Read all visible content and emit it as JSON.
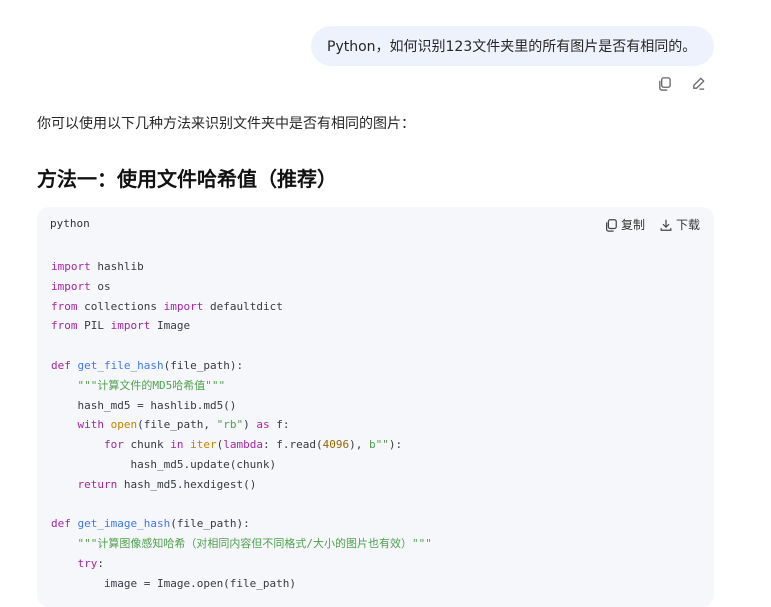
{
  "user_message": "Python，如何识别123文件夹里的所有图片是否有相同的。",
  "message_actions": {
    "copy_icon": "copy-icon",
    "edit_icon": "edit-icon"
  },
  "answer": {
    "intro": "你可以使用以下几种方法来识别文件夹中是否有相同的图片：",
    "heading": "方法一：使用文件哈希值（推荐）"
  },
  "code_block": {
    "language": "python",
    "copy_label": "复制",
    "download_label": "下载",
    "lines": [
      [
        [
          "kw",
          "import"
        ],
        [
          "",
          "hashlib"
        ]
      ],
      [
        [
          "kw",
          "import"
        ],
        [
          "",
          "os"
        ]
      ],
      [
        [
          "kw",
          "from"
        ],
        [
          "",
          "collections"
        ],
        [
          "kw",
          "import"
        ],
        [
          "",
          "defaultdict"
        ]
      ],
      [
        [
          "kw",
          "from"
        ],
        [
          "",
          "PIL"
        ],
        [
          "kw",
          "import"
        ],
        [
          "",
          "Image"
        ]
      ],
      [],
      [
        [
          "kw",
          "def"
        ],
        [
          "fn",
          "get_file_hash"
        ],
        [
          "",
          "(file_path):"
        ]
      ],
      [
        [
          "",
          "    "
        ],
        [
          "str",
          "\"\"\"计算文件的MD5哈希值\"\"\""
        ]
      ],
      [
        [
          "",
          "    hash_md5 = hashlib.md5()"
        ]
      ],
      [
        [
          "",
          "    "
        ],
        [
          "kw",
          "with"
        ],
        [
          "bi",
          "open"
        ],
        [
          "",
          "(file_path, "
        ],
        [
          "str",
          "\"rb\""
        ],
        [
          "",
          ") "
        ],
        [
          "kw",
          "as"
        ],
        [
          "",
          "f:"
        ]
      ],
      [
        [
          "",
          "        "
        ],
        [
          "kw",
          "for"
        ],
        [
          "",
          "chunk "
        ],
        [
          "kw",
          "in"
        ],
        [
          "bi",
          "iter"
        ],
        [
          "",
          "("
        ],
        [
          "kw",
          "lambda"
        ],
        [
          "",
          ": f.read("
        ],
        [
          "num",
          "4096"
        ],
        [
          "",
          "), "
        ],
        [
          "str",
          "b\"\""
        ],
        [
          "",
          "):"
        ]
      ],
      [
        [
          "",
          "            hash_md5.update(chunk)"
        ]
      ],
      [
        [
          "",
          "    "
        ],
        [
          "kw",
          "return"
        ],
        [
          "",
          "hash_md5.hexdigest()"
        ]
      ],
      [],
      [
        [
          "kw",
          "def"
        ],
        [
          "fn",
          "get_image_hash"
        ],
        [
          "",
          "(file_path):"
        ]
      ],
      [
        [
          "",
          "    "
        ],
        [
          "str",
          "\"\"\"计算图像感知哈希（对相同内容但不同格式/大小的图片也有效）\"\"\""
        ]
      ],
      [
        [
          "",
          "    "
        ],
        [
          "kw",
          "try"
        ],
        [
          "",
          ":"
        ]
      ],
      [
        [
          "",
          "        image = Image.open(file_path)"
        ]
      ]
    ]
  }
}
